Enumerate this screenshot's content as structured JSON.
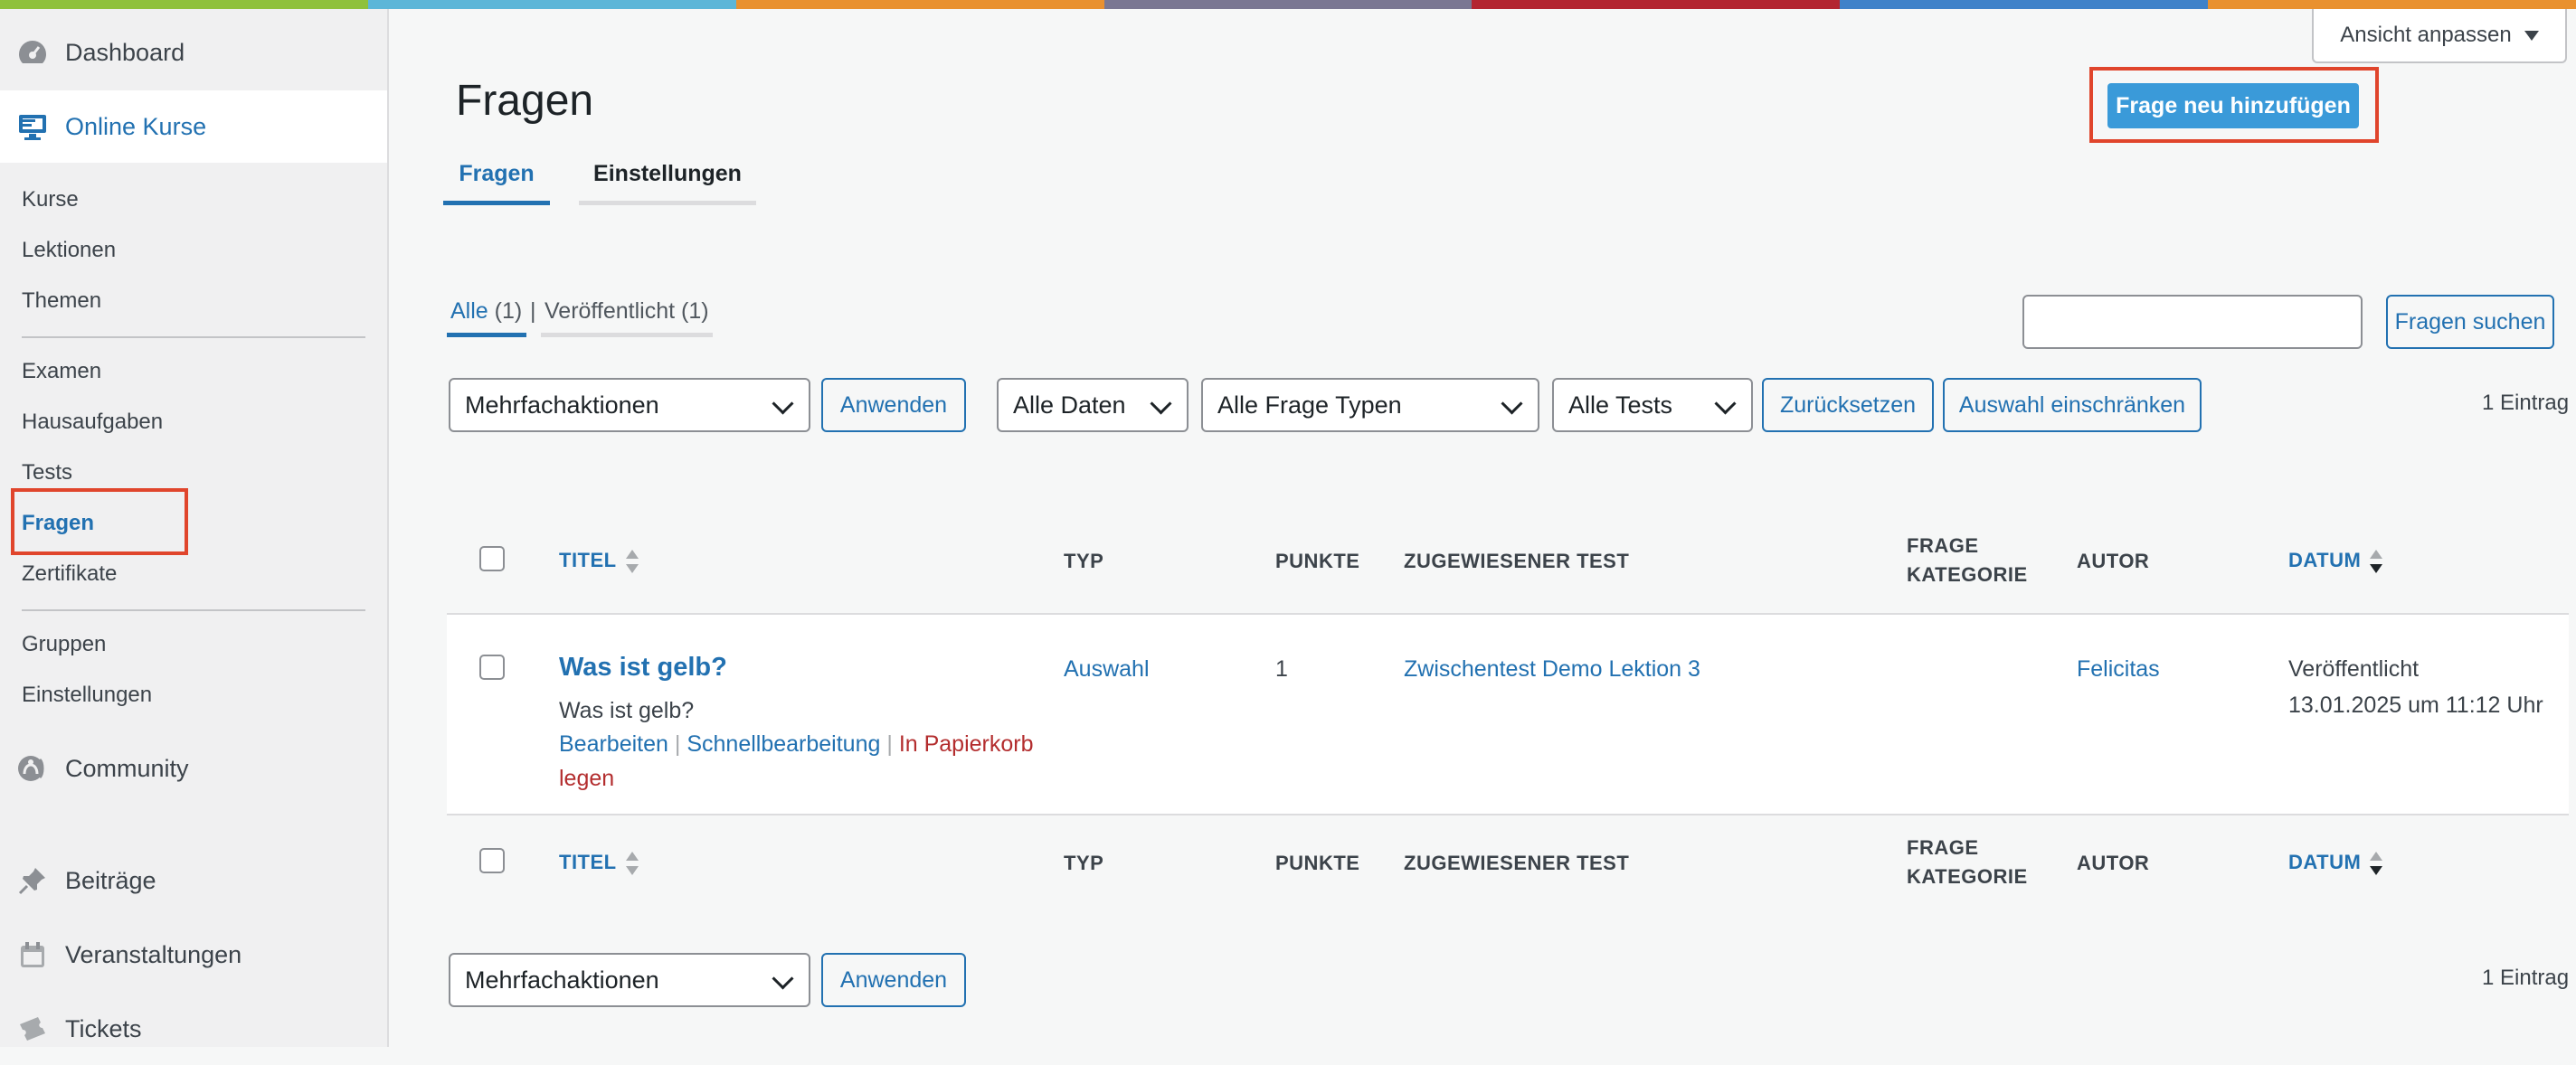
{
  "stripe_colors": [
    "#8fc13c",
    "#5cb6d8",
    "#e9912f",
    "#7a7792",
    "#b32530",
    "#3f82c9",
    "#e9912f"
  ],
  "accent_color": "#2271b1",
  "highlight_color": "#e0452c",
  "sidebar": {
    "dashboard": {
      "label": "Dashboard",
      "icon": "gauge-icon"
    },
    "online_kurse": {
      "label": "Online Kurse",
      "icon": "monitor-icon"
    },
    "submenu_1": [
      "Kurse",
      "Lektionen",
      "Themen"
    ],
    "submenu_2": [
      "Examen",
      "Hausaufgaben",
      "Tests",
      "Fragen",
      "Zertifikate"
    ],
    "submenu_3": [
      "Gruppen",
      "Einstellungen"
    ],
    "current_item": "Fragen",
    "community": {
      "label": "Community",
      "icon": "community-icon"
    },
    "beitraege": {
      "label": "Beiträge",
      "icon": "pin-icon"
    },
    "veranstaltungen": {
      "label": "Veranstaltungen",
      "icon": "calendar-icon"
    },
    "tickets": {
      "label": "Tickets",
      "icon": "ticket-icon"
    }
  },
  "header": {
    "title": "Fragen",
    "add_button": "Frage neu hinzufügen",
    "screen_options": "Ansicht anpassen",
    "tabs": [
      {
        "label": "Fragen",
        "active": true
      },
      {
        "label": "Einstellungen",
        "active": false
      }
    ]
  },
  "views": {
    "all_label": "Alle",
    "all_count": "(1)",
    "separator": "|",
    "published_label": "Veröffentlicht",
    "published_count": "(1)"
  },
  "search": {
    "value": "",
    "button": "Fragen suchen"
  },
  "filters": {
    "bulk_actions": "Mehrfachaktionen",
    "apply": "Anwenden",
    "dates": "Alle Daten",
    "types": "Alle Frage Typen",
    "tests": "Alle Tests",
    "reset": "Zurücksetzen",
    "filter": "Auswahl einschränken",
    "item_count": "1 Eintrag"
  },
  "table": {
    "columns": {
      "title": "TITEL",
      "type": "TYP",
      "points": "PUNKTE",
      "test": "ZUGEWIESENER TEST",
      "category_line1": "FRAGE",
      "category_line2": "KATEGORIE",
      "author": "AUTOR",
      "date": "DATUM"
    },
    "rows": [
      {
        "title": "Was ist gelb?",
        "excerpt": "Was ist gelb?",
        "action_edit": "Bearbeiten",
        "action_quick": "Schnellbearbeitung",
        "action_sep": "|",
        "action_trash": "In Papierkorb legen",
        "type": "Auswahl",
        "points": "1",
        "test": "Zwischentest Demo Lektion 3",
        "category": "",
        "author": "Felicitas",
        "status": "Veröffentlicht",
        "date": "13.01.2025 um 11:12 Uhr"
      }
    ]
  },
  "bottom": {
    "bulk_actions": "Mehrfachaktionen",
    "apply": "Anwenden",
    "item_count": "1 Eintrag"
  }
}
